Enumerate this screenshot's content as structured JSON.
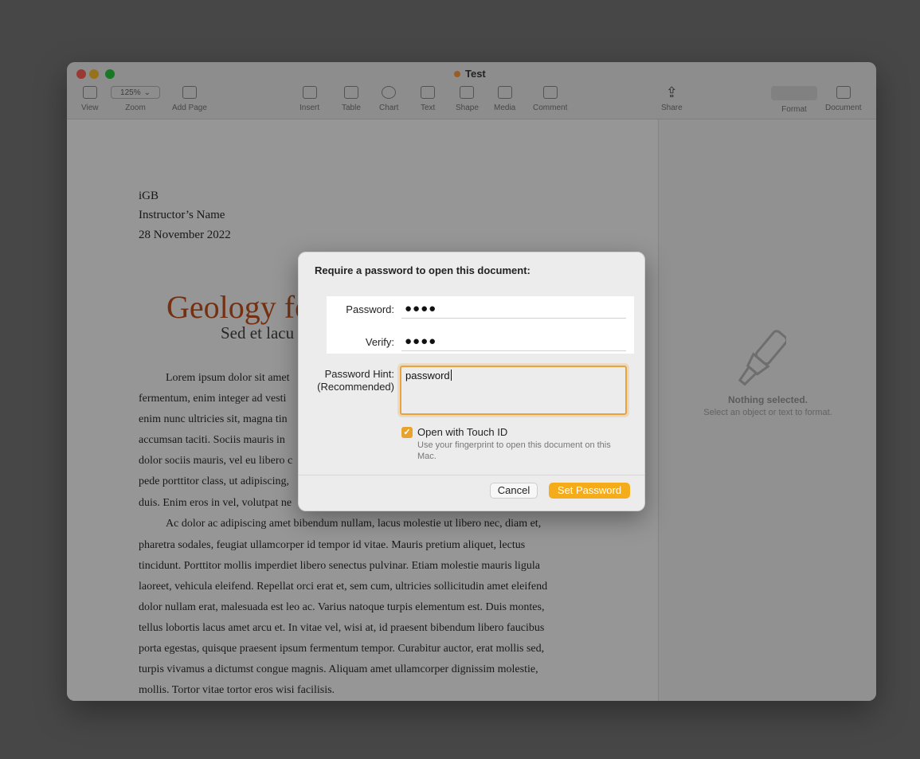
{
  "window": {
    "title": "Test",
    "toolbar": [
      {
        "id": "view",
        "label": "View"
      },
      {
        "id": "zoom",
        "label": "Zoom",
        "value": "125%"
      },
      {
        "id": "add-page",
        "label": "Add Page"
      },
      {
        "id": "insert",
        "label": "Insert"
      },
      {
        "id": "table",
        "label": "Table"
      },
      {
        "id": "chart",
        "label": "Chart"
      },
      {
        "id": "text",
        "label": "Text"
      },
      {
        "id": "shape",
        "label": "Shape"
      },
      {
        "id": "media",
        "label": "Media"
      },
      {
        "id": "comment",
        "label": "Comment"
      },
      {
        "id": "share",
        "label": "Share"
      },
      {
        "id": "format",
        "label": "Format"
      },
      {
        "id": "document",
        "label": "Document"
      }
    ]
  },
  "document": {
    "header_lines": [
      "iGB",
      "Instructor’s Name",
      "28 November 2022"
    ],
    "title": "Geology fo",
    "subtitle": "Sed et lacu",
    "paragraph1": [
      "Lorem ipsum dolor sit amet",
      "fermentum, enim integer ad vesti",
      "enim nunc ultricies sit, magna tin",
      "accumsan taciti. Sociis mauris in",
      "dolor sociis mauris, vel eu libero c",
      "pede porttitor class, ut adipiscing,",
      "duis. Enim eros in vel, volutpat ne"
    ],
    "paragraph2": [
      "Ac dolor ac adipiscing amet bibendum nullam, lacus molestie ut libero nec, diam et,",
      "pharetra sodales, feugiat ullamcorper id tempor id vitae. Mauris pretium aliquet, lectus",
      "tincidunt. Porttitor mollis imperdiet libero senectus pulvinar. Etiam molestie mauris ligula",
      "laoreet, vehicula eleifend. Repellat orci erat et, sem cum, ultricies sollicitudin amet eleifend",
      "dolor nullam erat, malesuada est leo ac. Varius natoque turpis elementum est. Duis montes,",
      "tellus lobortis lacus amet arcu et. In vitae vel, wisi at, id praesent bibendum libero faucibus",
      "porta egestas, quisque praesent ipsum fermentum tempor. Curabitur auctor, erat mollis sed,",
      "turpis vivamus a dictumst congue magnis. Aliquam amet ullamcorper dignissim molestie,",
      "mollis. Tortor vitae tortor eros wisi facilisis."
    ]
  },
  "inspector": {
    "empty_title": "Nothing selected.",
    "empty_subtitle": "Select an object or text to format."
  },
  "dialog": {
    "title": "Require a password to open this document:",
    "password_label": "Password:",
    "password_value": "●●●●",
    "verify_label": "Verify:",
    "verify_value": "●●●●",
    "hint_label_line1": "Password Hint:",
    "hint_label_line2": "(Recommended)",
    "hint_value": "password",
    "touch_id_label": "Open with Touch ID",
    "touch_id_checked": true,
    "touch_id_description": "Use your fingerprint to open this document on this Mac.",
    "cancel_label": "Cancel",
    "set_password_label": "Set Password",
    "accent_color": "#f5ac1a"
  }
}
